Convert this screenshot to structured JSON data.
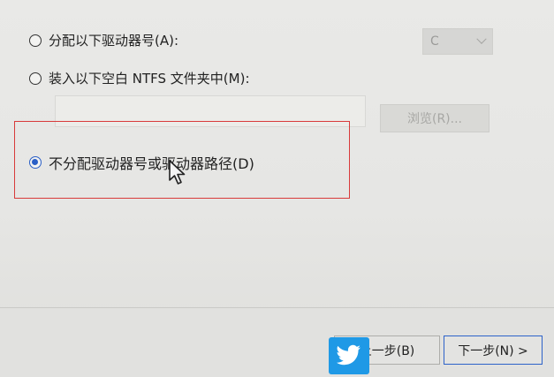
{
  "options": {
    "assign_letter_label": "分配以下驱动器号(A):",
    "drive_letter_value": "C",
    "mount_folder_label": "装入以下空白 NTFS 文件夹中(M):",
    "browse_label": "浏览(R)...",
    "no_letter_label": "不分配驱动器号或驱动器路径(D)",
    "selected": "no_letter"
  },
  "footer": {
    "back_label": "上一步(B)",
    "next_label": "下一步(N) >"
  },
  "colors": {
    "highlight_border": "#d83a3a",
    "radio_selected": "#2a5fc6",
    "watermark_bg": "#1f99e6"
  },
  "icons": {
    "cursor": "mouse-pointer-icon",
    "watermark": "twitter-bird-icon"
  }
}
